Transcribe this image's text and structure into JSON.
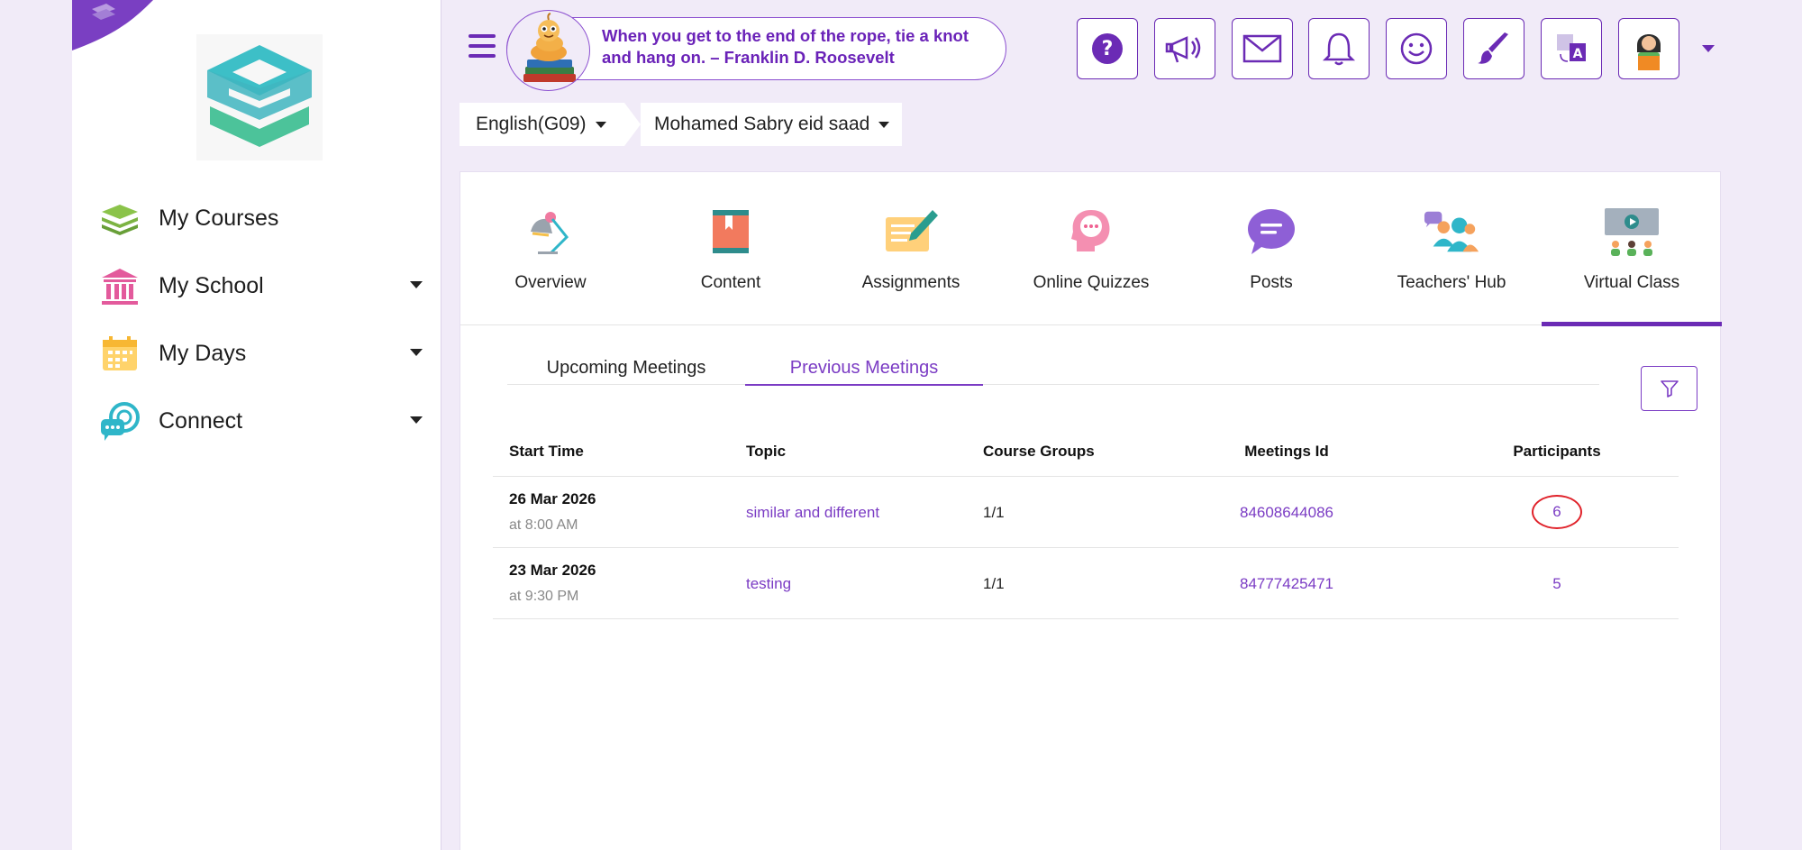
{
  "header": {
    "quote": "When you get to the end of the rope, tie a knot and hang on. – Franklin D. Roosevelt",
    "buttons": [
      "help-icon",
      "announcement-icon",
      "mail-icon",
      "bell-icon",
      "smiley-icon",
      "brush-icon",
      "translate-icon",
      "user-avatar-icon"
    ]
  },
  "sidebar": {
    "items": [
      {
        "label": "My Courses",
        "icon": "stacked-books-icon",
        "caret": false
      },
      {
        "label": "My School",
        "icon": "school-building-icon",
        "caret": true
      },
      {
        "label": "My Days",
        "icon": "calendar-icon",
        "caret": true
      },
      {
        "label": "Connect",
        "icon": "chat-bubbles-icon",
        "caret": true
      }
    ]
  },
  "breadcrumb": {
    "course": "English(G09)",
    "teacher": "Mohamed Sabry eid saad"
  },
  "tabs": [
    {
      "label": "Overview",
      "icon": "lamp-icon"
    },
    {
      "label": "Content",
      "icon": "book-icon"
    },
    {
      "label": "Assignments",
      "icon": "assignment-pen-icon"
    },
    {
      "label": "Online Quizzes",
      "icon": "quiz-head-icon"
    },
    {
      "label": "Posts",
      "icon": "speech-bubble-icon"
    },
    {
      "label": "Teachers' Hub",
      "icon": "teachers-group-icon"
    },
    {
      "label": "Virtual Class",
      "icon": "virtual-class-icon",
      "active": true
    }
  ],
  "subtabs": {
    "upcoming": "Upcoming Meetings",
    "previous": "Previous Meetings",
    "active": "previous"
  },
  "table": {
    "headers": {
      "start_time": "Start Time",
      "topic": "Topic",
      "course_groups": "Course Groups",
      "meetings_id": "Meetings Id",
      "participants": "Participants"
    },
    "rows": [
      {
        "date": "26 Mar 2026",
        "time": "at 8:00 AM",
        "topic": "similar and different",
        "groups": "1/1",
        "meeting_id": "84608644086",
        "participants": "6"
      },
      {
        "date": "23 Mar 2026",
        "time": "at 9:30 PM",
        "topic": "testing",
        "groups": "1/1",
        "meeting_id": "84777425471",
        "participants": "5"
      }
    ]
  },
  "colors": {
    "accent": "#6b2bb5",
    "link": "#7b3cc4",
    "background": "#f1ebf8",
    "highlight_circle": "#e0222a"
  }
}
